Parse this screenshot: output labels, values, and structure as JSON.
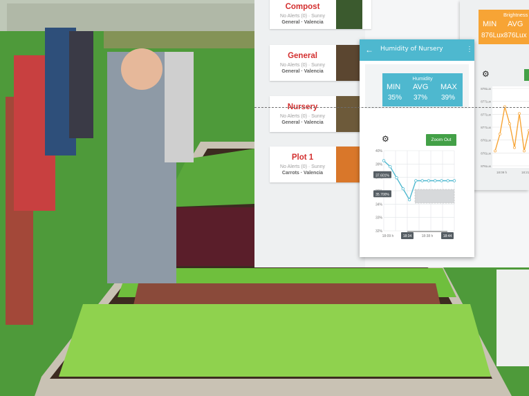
{
  "photo": {
    "sky": "#bfc8b8",
    "grass": "#4e9a3a",
    "bed_frame": "#c9c2b4",
    "soil": "#3c2b20",
    "lettuce": "#7cc444",
    "red_lettuce": "#5a1e2a"
  },
  "app": {
    "accent": "#4eb8cf",
    "orange": "#f7a435",
    "green_button": "#43a047",
    "name_color": "#d32f2f",
    "plots": [
      {
        "name": "Compost",
        "status": "No Alerts (0) · Sunny",
        "subtitle": "General · Valencia",
        "thumb_color": "#3b5a2e"
      },
      {
        "name": "General",
        "status": "No Alerts (0) · Sunny",
        "subtitle": "General · Valencia",
        "thumb_color": "#5b4630"
      },
      {
        "name": "Nursery",
        "status": "No Alerts (0) · Sunny",
        "subtitle": "General · Valencia",
        "thumb_color": "#6d5a3a"
      },
      {
        "name": "Plot 1",
        "status": "No Alerts (0) · Sunny",
        "subtitle": "Carrots · Valencia",
        "thumb_color": "#d9772a"
      }
    ],
    "main": {
      "title": "Humidity of Nursery",
      "back_icon": "arrow-left-icon",
      "more_icon": "more-vert-icon",
      "stats_caption": "Humidity",
      "min_label": "MIN",
      "avg_label": "AVG",
      "max_label": "MAX",
      "min_value": "35%",
      "avg_value": "37%",
      "max_value": "39%",
      "gear_icon": "gear-icon",
      "zoom_label": "Zoom Out"
    },
    "side": {
      "caption": "Brightness",
      "min_label": "MIN",
      "avg_label": "AVG",
      "values": "876Lux876Lux",
      "gear_icon": "gear-icon"
    }
  },
  "chart_data": [
    {
      "type": "line",
      "title": "",
      "y_ticks": [
        "40%",
        "39%",
        "37%",
        "36%",
        "34%",
        "33%",
        "32%"
      ],
      "x_ticks": [
        "18:09 h",
        "18:34",
        "18:38 h",
        "18:44"
      ],
      "x": [
        0,
        1,
        2,
        3,
        4,
        5,
        6,
        7,
        8,
        9,
        10,
        11
      ],
      "values": [
        39,
        38.4,
        37.3,
        36.2,
        35.1,
        37.0,
        37.0,
        37.0,
        37.0,
        37.0,
        37.0,
        37.0
      ],
      "ylim": [
        32,
        40
      ],
      "grid": true,
      "annotations": [
        "37.601%",
        "35.700%"
      ],
      "color": "#4eb8cf"
    },
    {
      "type": "line",
      "title": "",
      "y_ticks": [
        "878Lux",
        "877Lux",
        "877Lux",
        "877Lux",
        "876Lux",
        "876Lux",
        "876Lux"
      ],
      "x_ticks": [
        "18:09 h",
        "18:21"
      ],
      "x": [
        0,
        1,
        2,
        3,
        4,
        5,
        6,
        7
      ],
      "values": [
        876.3,
        876.8,
        877.6,
        877.1,
        876.4,
        877.4,
        876.3,
        876.9
      ],
      "ylim": [
        875.8,
        878.2
      ],
      "grid": true,
      "color": "#f7a435"
    }
  ]
}
